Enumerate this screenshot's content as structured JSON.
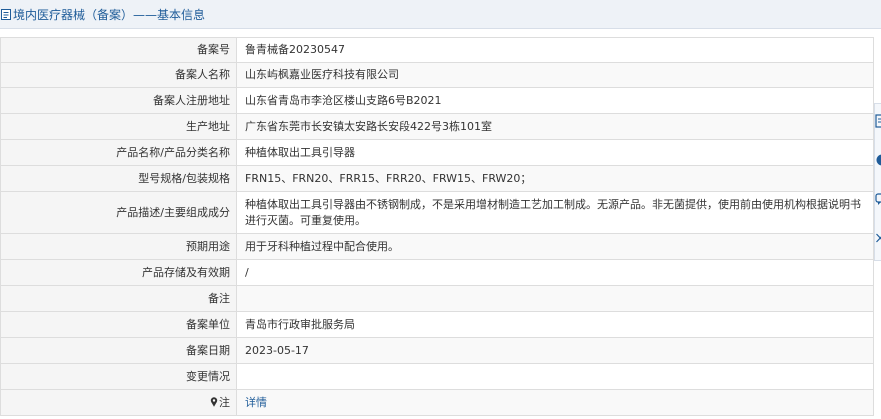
{
  "header": {
    "title": "境内医疗器械（备案）——基本信息"
  },
  "rows": [
    {
      "label": "备案号",
      "value": "鲁青械备20230547"
    },
    {
      "label": "备案人名称",
      "value": "山东屿枫嘉业医疗科技有限公司"
    },
    {
      "label": "备案人注册地址",
      "value": "山东省青岛市李沧区楼山支路6号B2021"
    },
    {
      "label": "生产地址",
      "value": "广东省东莞市长安镇太安路长安段422号3栋101室"
    },
    {
      "label": "产品名称/产品分类名称",
      "value": "种植体取出工具引导器"
    },
    {
      "label": "型号规格/包装规格",
      "value": "FRN15、FRN20、FRR15、FRR20、FRW15、FRW20；"
    },
    {
      "label": "产品描述/主要组成成分",
      "value": "种植体取出工具引导器由不锈钢制成，不是采用增材制造工艺加工制成。无源产品。非无菌提供，使用前由使用机构根据说明书进行灭菌。可重复使用。"
    },
    {
      "label": "预期用途",
      "value": "用于牙科种植过程中配合使用。"
    },
    {
      "label": "产品存储及有效期",
      "value": "/"
    },
    {
      "label": "备注",
      "value": ""
    },
    {
      "label": "备案单位",
      "value": "青岛市行政审批服务局"
    },
    {
      "label": "备案日期",
      "value": "2023-05-17"
    },
    {
      "label": "变更情况",
      "value": ""
    }
  ],
  "note_row": {
    "label": "注",
    "link": "详情",
    "icon": "pin-icon"
  },
  "side_tabs": [
    "document-icon",
    "circle-icon",
    "chat-icon",
    "close-icon"
  ],
  "colors": {
    "header_bg": "#eef2f7",
    "title": "#1f5c99",
    "label_bg": "#f5f5f5",
    "border": "#dddddd",
    "link": "#1f5c99"
  }
}
